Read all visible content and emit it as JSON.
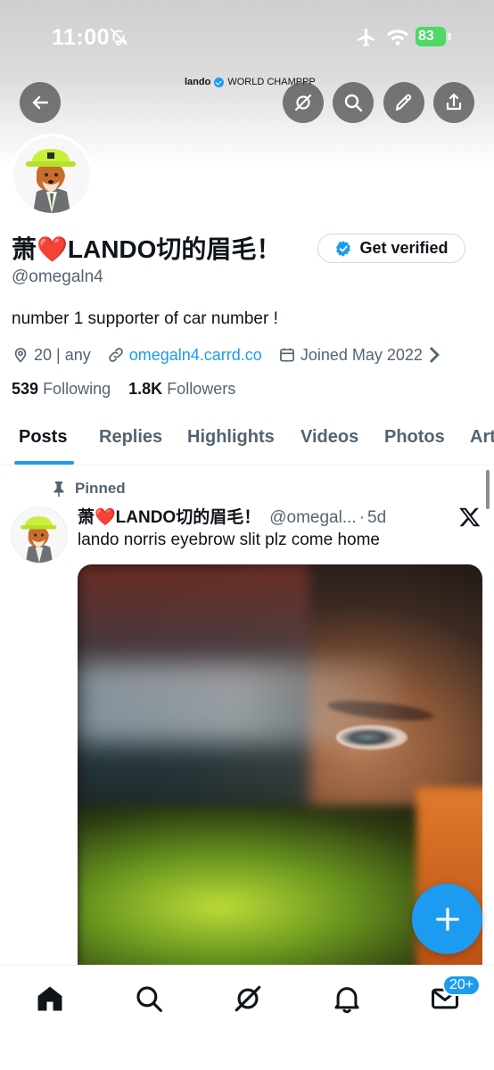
{
  "status_bar": {
    "time": "11:00",
    "battery": "83"
  },
  "banner": {
    "caption_name": "lando",
    "caption_text": "WORLD CHAMPPP"
  },
  "header_buttons": [
    "back-icon",
    "grok-icon",
    "search-icon",
    "edit-icon",
    "share-icon"
  ],
  "profile": {
    "display_name": "萧❤️LANDO切的眉毛！",
    "handle": "@omegaln4",
    "verify_label": "Get verified",
    "bio": "number 1 supporter of car number !",
    "location": "20 | any",
    "website": "omegaln4.carrd.co",
    "joined": "Joined May 2022",
    "following_count": "539",
    "following_label": "Following",
    "followers_count": "1.8K",
    "followers_label": "Followers"
  },
  "tabs": [
    {
      "label": "Posts",
      "active": true
    },
    {
      "label": "Replies"
    },
    {
      "label": "Highlights"
    },
    {
      "label": "Videos"
    },
    {
      "label": "Photos"
    },
    {
      "label": "Articles"
    }
  ],
  "tweet": {
    "pinned_label": "Pinned",
    "author_name": "萧❤️LANDO切的眉毛！",
    "author_handle": "@omegal...",
    "separator": "·",
    "time": "5d",
    "text": "lando norris eyebrow slit plz come home"
  },
  "bottom_nav": {
    "items": [
      "home-icon",
      "search-icon",
      "grok-icon",
      "notifications-icon",
      "messages-icon"
    ],
    "messages_badge": "20+"
  },
  "colors": {
    "accent": "#1d9bf0",
    "text": "#0f1419",
    "secondary": "#536471",
    "battery": "#4cd964"
  }
}
